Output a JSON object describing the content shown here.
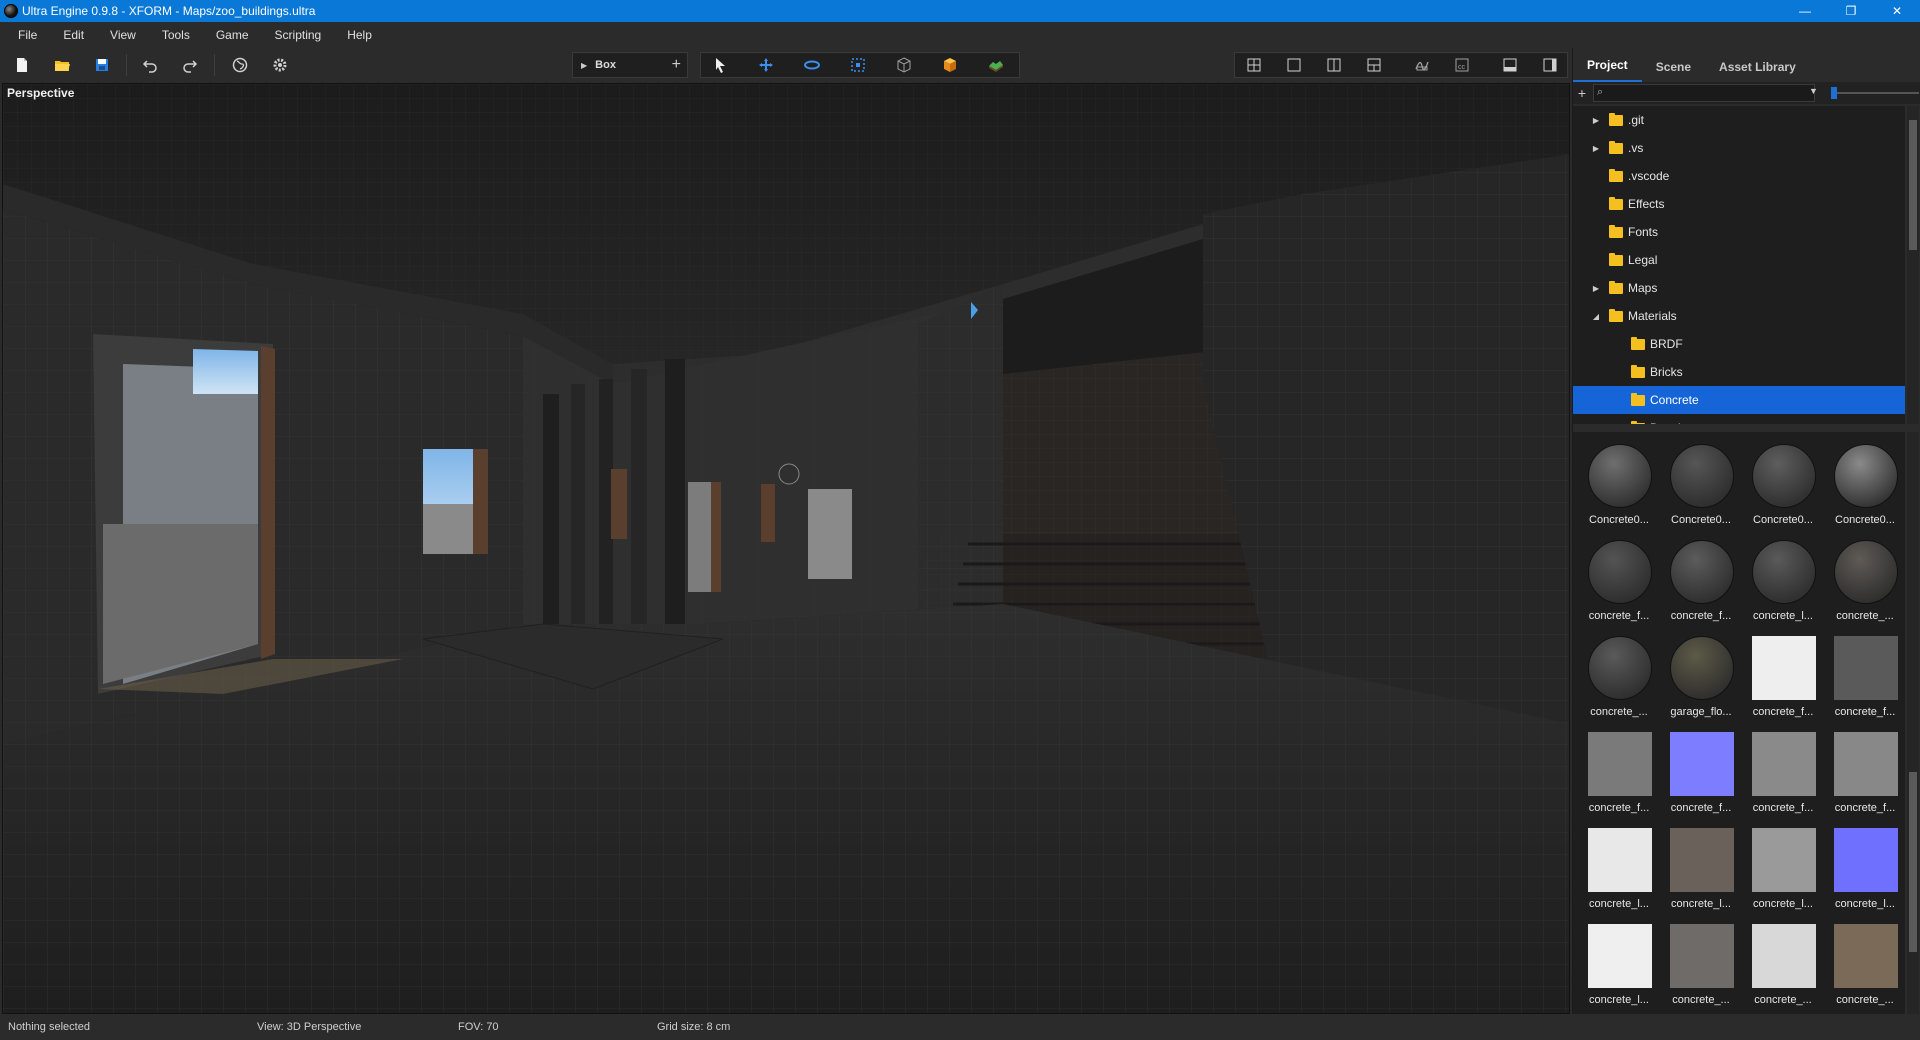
{
  "window": {
    "title": "Ultra Engine 0.9.8 - XFORM - Maps/zoo_buildings.ultra",
    "controls": [
      "—",
      "❐",
      "✕"
    ]
  },
  "menu": [
    "File",
    "Edit",
    "View",
    "Tools",
    "Game",
    "Scripting",
    "Help"
  ],
  "toolbar": {
    "primitive_label": "Box",
    "icons": [
      "new-file-icon",
      "open-folder-icon",
      "save-icon",
      "undo-icon",
      "redo-icon",
      "globe-icon",
      "settings-gear-icon",
      "select-pointer-icon",
      "move-icon",
      "rotate-icon",
      "scale-icon",
      "wireframe-box-icon",
      "solid-box-icon",
      "terrain-icon",
      "quad-view-icon",
      "single-view-icon",
      "split-vertical-icon",
      "split-horizontal-icon",
      "physics-icon",
      "collision-icon",
      "bottom-panel-icon",
      "side-panel-icon"
    ]
  },
  "viewport": {
    "label": "Perspective"
  },
  "panel": {
    "tabs": [
      {
        "label": "Project",
        "active": true
      },
      {
        "label": "Scene",
        "active": false
      },
      {
        "label": "Asset Library",
        "active": false
      }
    ],
    "search_placeholder": "",
    "tree": [
      {
        "label": ".git",
        "depth": 1,
        "expander": "collapsed"
      },
      {
        "label": ".vs",
        "depth": 1,
        "expander": "collapsed"
      },
      {
        "label": ".vscode",
        "depth": 1,
        "expander": "none"
      },
      {
        "label": "Effects",
        "depth": 1,
        "expander": "none"
      },
      {
        "label": "Fonts",
        "depth": 1,
        "expander": "none"
      },
      {
        "label": "Legal",
        "depth": 1,
        "expander": "none"
      },
      {
        "label": "Maps",
        "depth": 1,
        "expander": "collapsed"
      },
      {
        "label": "Materials",
        "depth": 1,
        "expander": "expanded"
      },
      {
        "label": "BRDF",
        "depth": 2,
        "expander": "none"
      },
      {
        "label": "Bricks",
        "depth": 2,
        "expander": "none"
      },
      {
        "label": "Concrete",
        "depth": 2,
        "expander": "none",
        "selected": true
      },
      {
        "label": "Decals",
        "depth": 2,
        "expander": "none"
      }
    ],
    "assets": [
      {
        "label": "Concrete0...",
        "kind": "sphere",
        "color": "#6f6f6f"
      },
      {
        "label": "Concrete0...",
        "kind": "sphere",
        "color": "#565656"
      },
      {
        "label": "Concrete0...",
        "kind": "sphere",
        "color": "#5e5e5e"
      },
      {
        "label": "Concrete0...",
        "kind": "sphere",
        "color": "#8a8a8a"
      },
      {
        "label": "concrete_f...",
        "kind": "sphere",
        "color": "#545454"
      },
      {
        "label": "concrete_f...",
        "kind": "sphere",
        "color": "#5c5c5c"
      },
      {
        "label": "concrete_l...",
        "kind": "sphere",
        "color": "#5a5a5a"
      },
      {
        "label": "concrete_...",
        "kind": "sphere",
        "color": "#5f5a55"
      },
      {
        "label": "concrete_...",
        "kind": "sphere",
        "color": "#5a5a5a"
      },
      {
        "label": "garage_flo...",
        "kind": "sphere",
        "color": "#5e5a48"
      },
      {
        "label": "concrete_f...",
        "kind": "flat",
        "color": "#eeeeee"
      },
      {
        "label": "concrete_f...",
        "kind": "flat",
        "color": "#5a5a5a"
      },
      {
        "label": "concrete_f...",
        "kind": "flat",
        "color": "#7a7a7a"
      },
      {
        "label": "concrete_f...",
        "kind": "flat",
        "color": "#7d7dff"
      },
      {
        "label": "concrete_f...",
        "kind": "flat",
        "color": "#8a8a8a"
      },
      {
        "label": "concrete_f...",
        "kind": "flat",
        "color": "#888888"
      },
      {
        "label": "concrete_l...",
        "kind": "flat",
        "color": "#e8e8e8"
      },
      {
        "label": "concrete_l...",
        "kind": "flat",
        "color": "#6a625a"
      },
      {
        "label": "concrete_l...",
        "kind": "flat",
        "color": "#9a9a9a"
      },
      {
        "label": "concrete_l...",
        "kind": "flat",
        "color": "#7070ff"
      },
      {
        "label": "concrete_l...",
        "kind": "flat",
        "color": "#efefef"
      },
      {
        "label": "concrete_...",
        "kind": "flat",
        "color": "#6e6b68"
      },
      {
        "label": "concrete_...",
        "kind": "flat",
        "color": "#d8d8d8"
      },
      {
        "label": "concrete_...",
        "kind": "flat",
        "color": "#7b6a58"
      }
    ]
  },
  "status": {
    "selection": "Nothing selected",
    "view": "View: 3D Perspective",
    "fov": "FOV: 70",
    "grid": "Grid size: 8 cm"
  },
  "colors": {
    "accent": "#1565d8",
    "titlebar": "#0a78d7",
    "folder": "#f4c020"
  }
}
